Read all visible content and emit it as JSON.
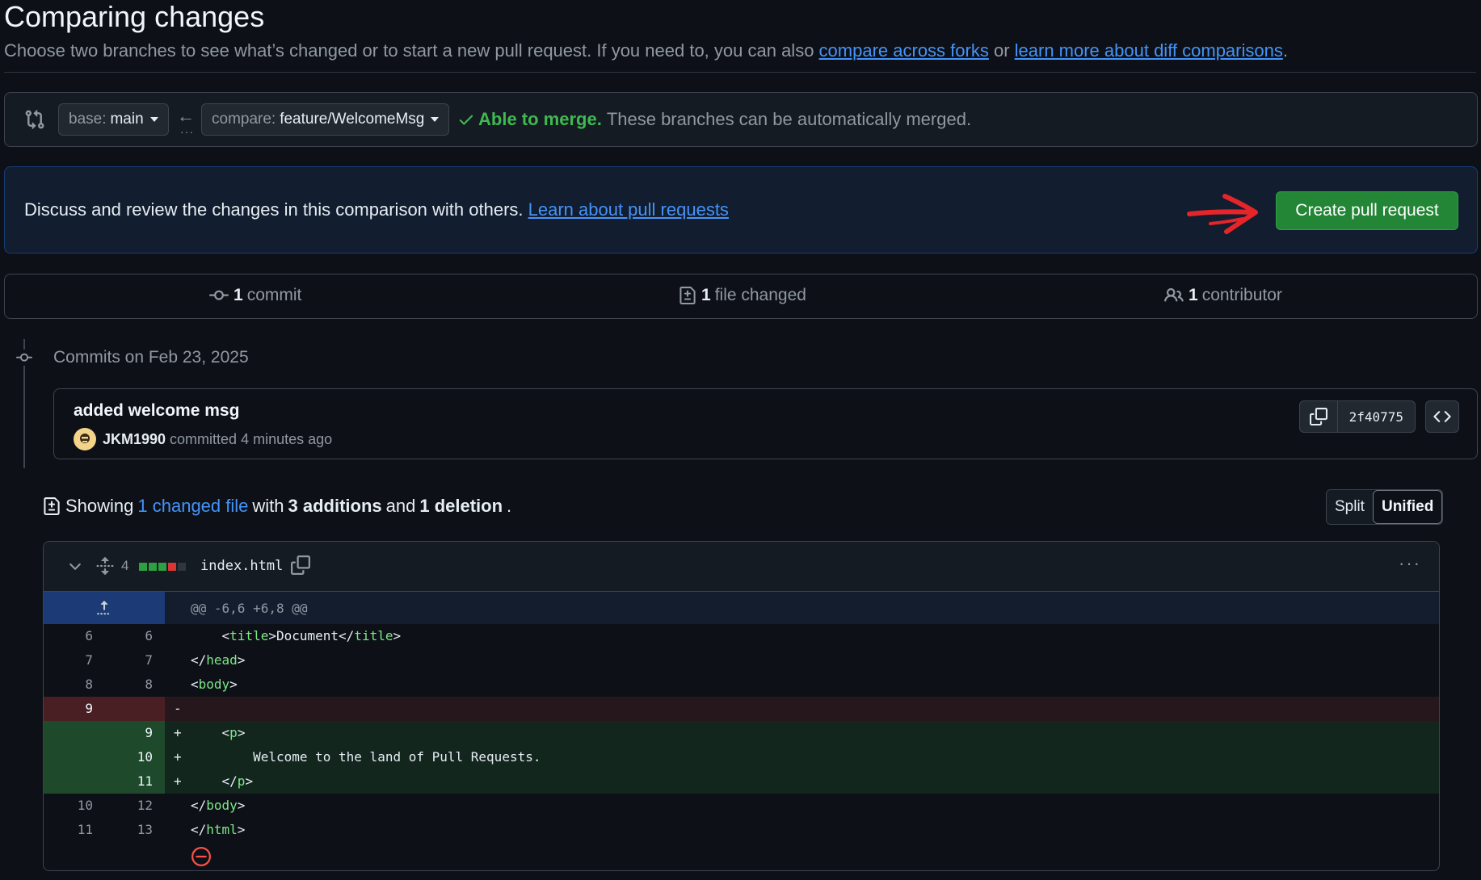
{
  "page": {
    "title": "Comparing changes",
    "subtitle_prefix": "Choose two branches to see what’s changed or to start a new pull request. If you need to, you can also ",
    "link_forks": "compare across forks",
    "subtitle_or": " or ",
    "link_diff": "learn more about diff comparisons",
    "subtitle_end": "."
  },
  "range": {
    "base_label": "base:",
    "base_value": "main",
    "compare_label": "compare:",
    "compare_value": "feature/WelcomeMsg",
    "merge_ok": "Able to merge.",
    "merge_msg": "These branches can be automatically merged."
  },
  "discuss": {
    "text": "Discuss and review the changes in this comparison with others. ",
    "link": "Learn about pull requests",
    "button": "Create pull request"
  },
  "summary": {
    "commits_count": "1",
    "commits_label": "commit",
    "files_count": "1",
    "files_label": "file changed",
    "contrib_count": "1",
    "contrib_label": "contributor"
  },
  "commits": {
    "heading": "Commits on Feb 23, 2025",
    "message": "added welcome msg",
    "author": "JKM1990",
    "meta": "committed 4 minutes ago",
    "sha": "2f40775"
  },
  "showing": {
    "prefix": "Showing",
    "files_link": "1 changed file",
    "with": "with",
    "additions": "3 additions",
    "and": "and",
    "deletions": "1 deletion",
    "end": "."
  },
  "view_toggle": {
    "split": "Split",
    "unified": "Unified"
  },
  "file": {
    "changes_count": "4",
    "name": "index.html",
    "hunk_header": "@@ -6,6 +6,8 @@"
  },
  "diff": [
    {
      "old": "6",
      "new": "6",
      "sign": "",
      "pre": "    <",
      "tag": "title",
      "mid": ">Document</",
      "tag2": "title",
      "post": ">",
      "type": "ctx"
    },
    {
      "old": "7",
      "new": "7",
      "sign": "",
      "pre": "</",
      "tag": "head",
      "mid": ">",
      "tag2": "",
      "post": "",
      "type": "ctx"
    },
    {
      "old": "8",
      "new": "8",
      "sign": "",
      "pre": "<",
      "tag": "body",
      "mid": ">",
      "tag2": "",
      "post": "",
      "type": "ctx"
    },
    {
      "old": "9",
      "new": "",
      "sign": "-",
      "pre": "",
      "tag": "",
      "mid": "",
      "tag2": "",
      "post": "",
      "type": "del"
    },
    {
      "old": "",
      "new": "9",
      "sign": "+",
      "pre": "    <",
      "tag": "p",
      "mid": ">",
      "tag2": "",
      "post": "",
      "type": "add"
    },
    {
      "old": "",
      "new": "10",
      "sign": "+",
      "pre": "        Welcome to the land of Pull Requests.",
      "tag": "",
      "mid": "",
      "tag2": "",
      "post": "",
      "type": "add"
    },
    {
      "old": "",
      "new": "11",
      "sign": "+",
      "pre": "    </",
      "tag": "p",
      "mid": ">",
      "tag2": "",
      "post": "",
      "type": "add"
    },
    {
      "old": "10",
      "new": "12",
      "sign": "",
      "pre": "</",
      "tag": "body",
      "mid": ">",
      "tag2": "",
      "post": "",
      "type": "ctx"
    },
    {
      "old": "11",
      "new": "13",
      "sign": "",
      "pre": "</",
      "tag": "html",
      "mid": ">",
      "tag2": "",
      "post": "",
      "type": "ctx"
    }
  ],
  "colors": {
    "accent_green": "#238636",
    "success": "#3fb950",
    "link": "#4493f8",
    "annotation_arrow": "#e5252a"
  }
}
